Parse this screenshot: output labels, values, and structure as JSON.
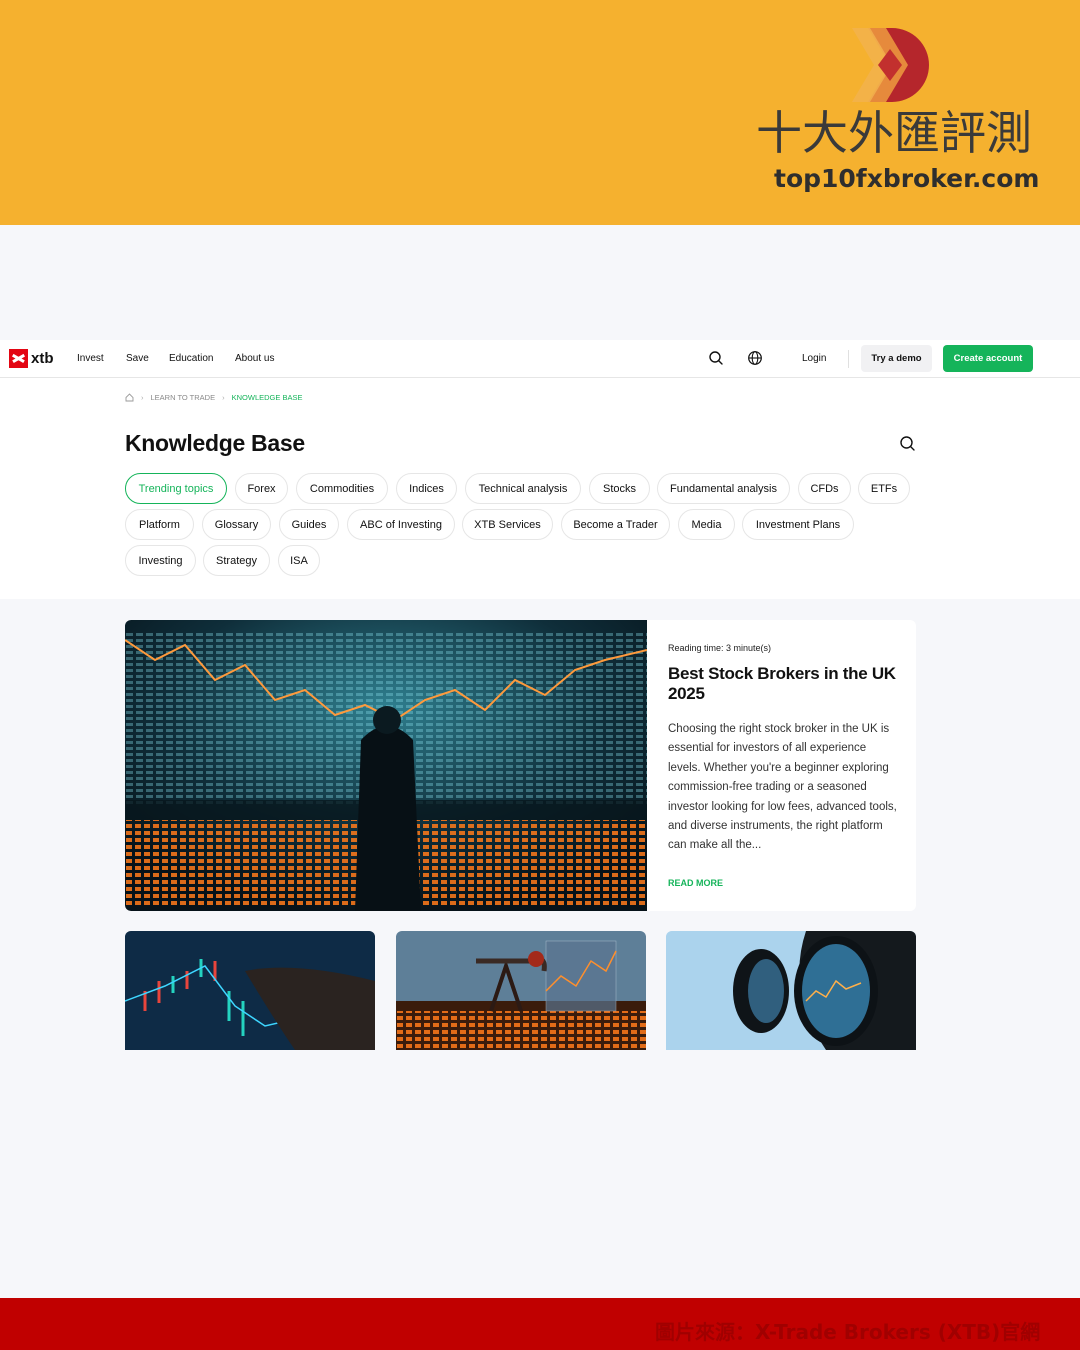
{
  "banner": {
    "brand_cn": "十大外匯評測",
    "brand_url": "top10fxbroker.com"
  },
  "nav": {
    "logo_text": "xtb",
    "links": [
      "Invest",
      "Save",
      "Education",
      "About us"
    ],
    "login": "Login",
    "try_demo": "Try a demo",
    "create_account": "Create account"
  },
  "breadcrumb": {
    "items": [
      "LEARN TO TRADE",
      "KNOWLEDGE BASE"
    ]
  },
  "page_title": "Knowledge Base",
  "topics": [
    "Trending topics",
    "Forex",
    "Commodities",
    "Indices",
    "Technical analysis",
    "Stocks",
    "Fundamental analysis",
    "CFDs",
    "ETFs",
    "Platform",
    "Glossary",
    "Guides",
    "ABC of Investing",
    "XTB Services",
    "Become a Trader",
    "Media",
    "Investment Plans",
    "Investing",
    "Strategy",
    "ISA"
  ],
  "featured": {
    "reading_time": "Reading time: 3 minute(s)",
    "title": "Best Stock Brokers in the UK 2025",
    "excerpt": "Choosing the right stock broker in the UK is essential for investors of all experience levels. Whether you're a beginner exploring commission-free trading or a seasoned investor looking for low fees, advanced tools, and diverse instruments, the right platform can make all the...",
    "read_more": "READ MORE"
  },
  "footer": {
    "source": "圖片來源：X-Trade Brokers (XTB)官網"
  },
  "colors": {
    "banner": "#f5b12f",
    "accent_green": "#15b45a",
    "xtb_red": "#e30613",
    "footer_red": "#c00000"
  }
}
